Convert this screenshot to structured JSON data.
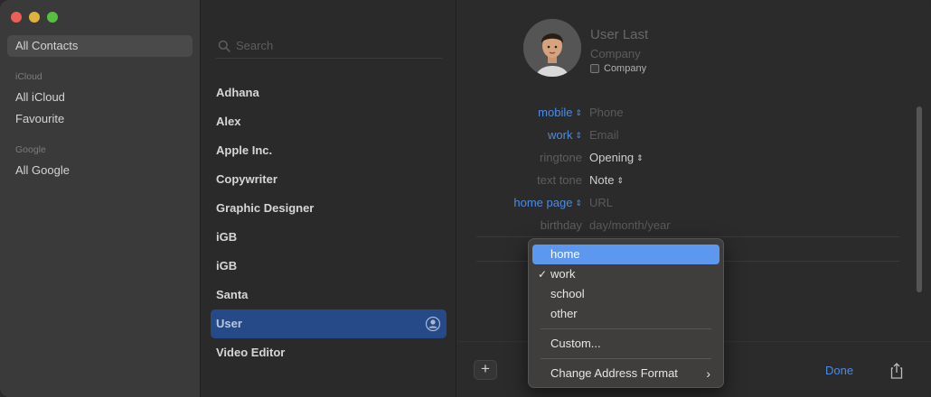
{
  "sidebar": {
    "items": [
      {
        "label": "All Contacts",
        "selected": true
      },
      {
        "label": "All iCloud",
        "selected": false
      },
      {
        "label": "Favourite",
        "selected": false
      },
      {
        "label": "All Google",
        "selected": false
      }
    ],
    "groups": [
      "iCloud",
      "Google"
    ]
  },
  "list": {
    "search_placeholder": "Search",
    "contacts": [
      "Adhana",
      "Alex",
      "Apple Inc.",
      "Copywriter",
      "Graphic Designer",
      "iGB",
      "iGB",
      "Santa",
      "User",
      "Video Editor"
    ],
    "selected_index": 8
  },
  "detail": {
    "name_placeholder": "User  Last",
    "company_placeholder": "Company",
    "company_checkbox_label": "Company",
    "fields": [
      {
        "label": "mobile",
        "label_style": "blue",
        "has_chevron": true,
        "value": "Phone",
        "value_style": "placeholder",
        "value_chevron": false
      },
      {
        "label": "work",
        "label_style": "blue",
        "has_chevron": true,
        "value": "Email",
        "value_style": "placeholder",
        "value_chevron": false
      },
      {
        "label": "ringtone",
        "label_style": "dim",
        "has_chevron": false,
        "value": "Opening",
        "value_style": "value",
        "value_chevron": true
      },
      {
        "label": "text tone",
        "label_style": "dim",
        "has_chevron": false,
        "value": "Note",
        "value_style": "value",
        "value_chevron": true
      },
      {
        "label": "home page",
        "label_style": "blue",
        "has_chevron": true,
        "value": "URL",
        "value_style": "placeholder",
        "value_chevron": false
      },
      {
        "label": "birthday",
        "label_style": "dim",
        "has_chevron": false,
        "value": "day/month/year",
        "value_style": "placeholder",
        "value_chevron": false
      }
    ],
    "done_label": "Done",
    "add_label": "+"
  },
  "menu": {
    "items": [
      "home",
      "work",
      "school",
      "other"
    ],
    "highlighted": "home",
    "checked": "work",
    "custom_label": "Custom...",
    "address_format_label": "Change Address Format",
    "submenu_arrow": "›"
  },
  "colors": {
    "accent": "#4d8be0",
    "selection": "#254a87",
    "menu_highlight": "#5c97f0"
  }
}
